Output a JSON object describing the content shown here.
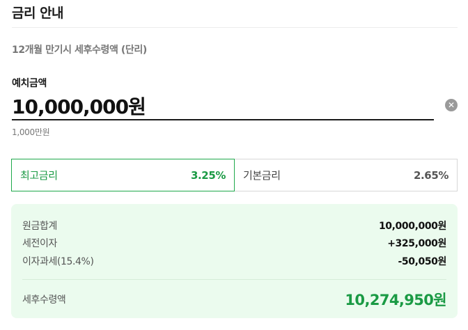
{
  "header": {
    "title": "금리 안내"
  },
  "subtitle": "12개월 만기시 세후수령액 (단리)",
  "deposit": {
    "label": "예치금액",
    "value": "10,000,000원",
    "hint": "1,000만원",
    "clear_icon": "clear-icon"
  },
  "rate_tabs": [
    {
      "label": "최고금리",
      "value": "3.25%",
      "selected": true
    },
    {
      "label": "기본금리",
      "value": "2.65%",
      "selected": false
    }
  ],
  "summary": {
    "rows": [
      {
        "label": "원금합계",
        "value": "10,000,000원"
      },
      {
        "label": "세전이자",
        "value": "+325,000원"
      },
      {
        "label": "이자과세(15.4%)",
        "value": "-50,050원"
      }
    ],
    "total": {
      "label": "세후수령액",
      "value": "10,274,950원"
    }
  },
  "colors": {
    "accent": "#1a9a44",
    "summary_bg": "#ebfbee",
    "border": "#d7d7d7"
  }
}
